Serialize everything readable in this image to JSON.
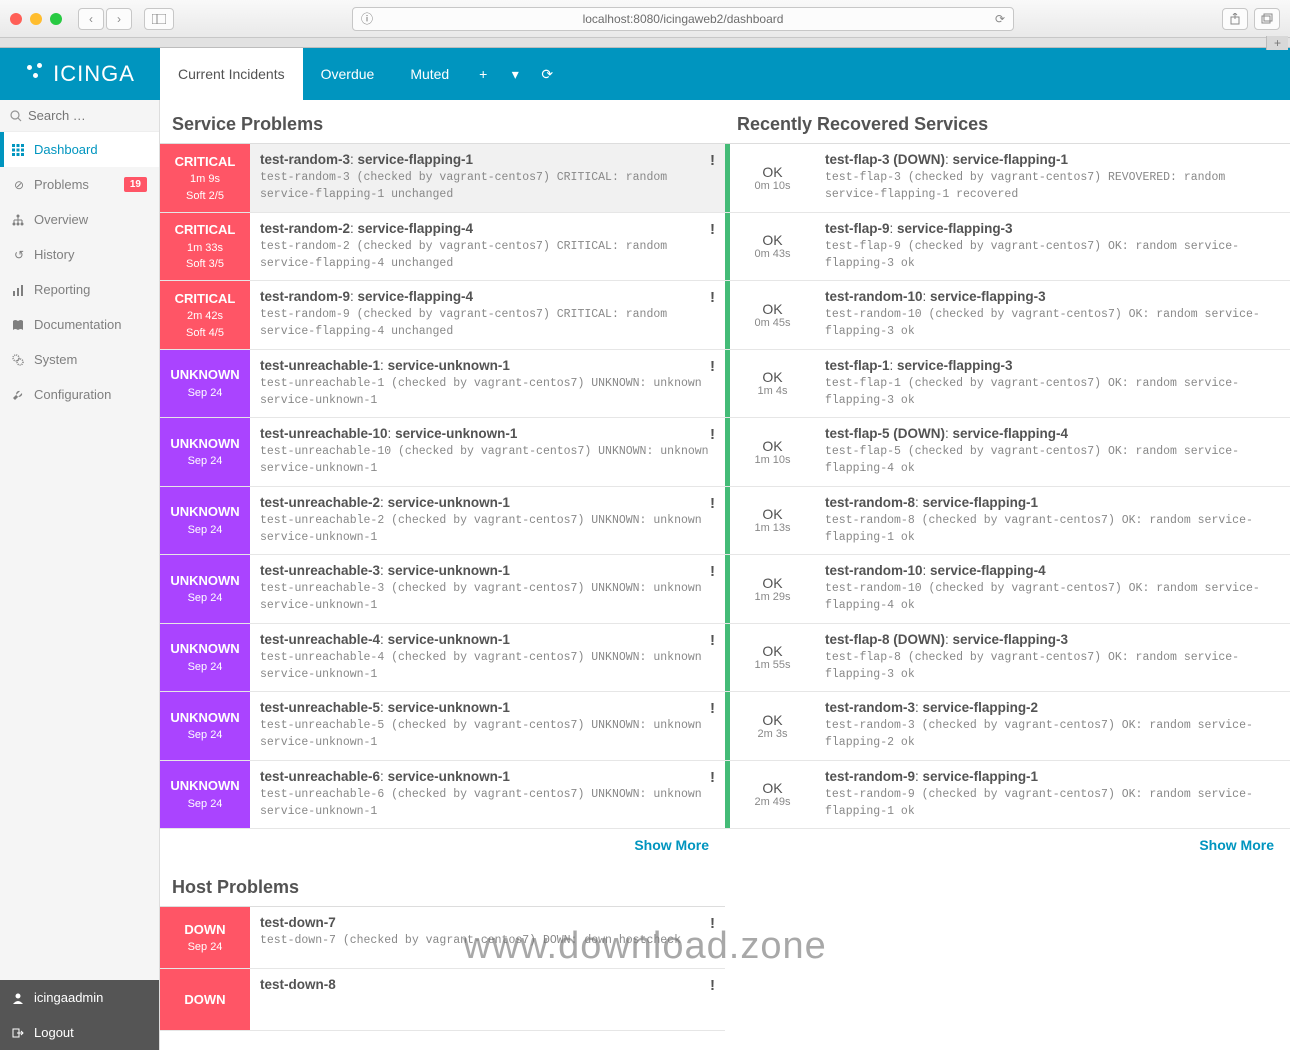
{
  "browser": {
    "url": "localhost:8080/icingaweb2/dashboard"
  },
  "logo_text": "ICINGA",
  "tabs": {
    "current": "Current Incidents",
    "overdue": "Overdue",
    "muted": "Muted"
  },
  "search_placeholder": "Search …",
  "sidebar": {
    "dashboard": "Dashboard",
    "problems": "Problems",
    "problems_badge": "19",
    "overview": "Overview",
    "history": "History",
    "reporting": "Reporting",
    "documentation": "Documentation",
    "system": "System",
    "configuration": "Configuration",
    "user": "icingaadmin",
    "logout": "Logout"
  },
  "headings": {
    "service_problems": "Service Problems",
    "recovered": "Recently Recovered Services",
    "host_problems": "Host Problems",
    "show_more": "Show More"
  },
  "service_problems": [
    {
      "status": "CRITICAL",
      "time": "1m 9s",
      "soft": "Soft 2/5",
      "cls": "critical",
      "host": "test-random-3",
      "svc": "service-flapping-1",
      "msg": "test-random-3 (checked by vagrant-centos7) CRITICAL: random service-flapping-1 unchanged",
      "hover": true
    },
    {
      "status": "CRITICAL",
      "time": "1m 33s",
      "soft": "Soft 3/5",
      "cls": "critical",
      "host": "test-random-2",
      "svc": "service-flapping-4",
      "msg": "test-random-2 (checked by vagrant-centos7) CRITICAL: random service-flapping-4 unchanged"
    },
    {
      "status": "CRITICAL",
      "time": "2m 42s",
      "soft": "Soft 4/5",
      "cls": "critical",
      "host": "test-random-9",
      "svc": "service-flapping-4",
      "msg": "test-random-9 (checked by vagrant-centos7) CRITICAL: random service-flapping-4 unchanged"
    },
    {
      "status": "UNKNOWN",
      "time": "Sep 24",
      "cls": "unknown",
      "host": "test-unreachable-1",
      "svc": "service-unknown-1",
      "msg": "test-unreachable-1 (checked by vagrant-centos7) UNKNOWN: unknown service-unknown-1"
    },
    {
      "status": "UNKNOWN",
      "time": "Sep 24",
      "cls": "unknown",
      "host": "test-unreachable-10",
      "svc": "service-unknown-1",
      "msg": "test-unreachable-10 (checked by vagrant-centos7) UNKNOWN: unknown service-unknown-1"
    },
    {
      "status": "UNKNOWN",
      "time": "Sep 24",
      "cls": "unknown",
      "host": "test-unreachable-2",
      "svc": "service-unknown-1",
      "msg": "test-unreachable-2 (checked by vagrant-centos7) UNKNOWN: unknown service-unknown-1"
    },
    {
      "status": "UNKNOWN",
      "time": "Sep 24",
      "cls": "unknown",
      "host": "test-unreachable-3",
      "svc": "service-unknown-1",
      "msg": "test-unreachable-3 (checked by vagrant-centos7) UNKNOWN: unknown service-unknown-1"
    },
    {
      "status": "UNKNOWN",
      "time": "Sep 24",
      "cls": "unknown",
      "host": "test-unreachable-4",
      "svc": "service-unknown-1",
      "msg": "test-unreachable-4 (checked by vagrant-centos7) UNKNOWN: unknown service-unknown-1"
    },
    {
      "status": "UNKNOWN",
      "time": "Sep 24",
      "cls": "unknown",
      "host": "test-unreachable-5",
      "svc": "service-unknown-1",
      "msg": "test-unreachable-5 (checked by vagrant-centos7) UNKNOWN: unknown service-unknown-1"
    },
    {
      "status": "UNKNOWN",
      "time": "Sep 24",
      "cls": "unknown",
      "host": "test-unreachable-6",
      "svc": "service-unknown-1",
      "msg": "test-unreachable-6 (checked by vagrant-centos7) UNKNOWN: unknown service-unknown-1"
    }
  ],
  "recovered": [
    {
      "time": "0m 10s",
      "host": "test-flap-3 (DOWN)",
      "svc": "service-flapping-1",
      "msg": "test-flap-3 (checked by vagrant-centos7) REVOVERED: random service-flapping-1 recovered"
    },
    {
      "time": "0m 43s",
      "host": "test-flap-9",
      "svc": "service-flapping-3",
      "msg": "test-flap-9 (checked by vagrant-centos7) OK: random service-flapping-3 ok"
    },
    {
      "time": "0m 45s",
      "host": "test-random-10",
      "svc": "service-flapping-3",
      "msg": "test-random-10 (checked by vagrant-centos7) OK: random service-flapping-3 ok"
    },
    {
      "time": "1m 4s",
      "host": "test-flap-1",
      "svc": "service-flapping-3",
      "msg": "test-flap-1 (checked by vagrant-centos7) OK: random service-flapping-3 ok"
    },
    {
      "time": "1m 10s",
      "host": "test-flap-5 (DOWN)",
      "svc": "service-flapping-4",
      "msg": "test-flap-5 (checked by vagrant-centos7) OK: random service-flapping-4 ok"
    },
    {
      "time": "1m 13s",
      "host": "test-random-8",
      "svc": "service-flapping-1",
      "msg": "test-random-8 (checked by vagrant-centos7) OK: random service-flapping-1 ok"
    },
    {
      "time": "1m 29s",
      "host": "test-random-10",
      "svc": "service-flapping-4",
      "msg": "test-random-10 (checked by vagrant-centos7) OK: random service-flapping-4 ok"
    },
    {
      "time": "1m 55s",
      "host": "test-flap-8 (DOWN)",
      "svc": "service-flapping-3",
      "msg": "test-flap-8 (checked by vagrant-centos7) OK: random service-flapping-3 ok"
    },
    {
      "time": "2m 3s",
      "host": "test-random-3",
      "svc": "service-flapping-2",
      "msg": "test-random-3 (checked by vagrant-centos7) OK: random service-flapping-2 ok"
    },
    {
      "time": "2m 49s",
      "host": "test-random-9",
      "svc": "service-flapping-1",
      "msg": "test-random-9 (checked by vagrant-centos7) OK: random service-flapping-1 ok"
    }
  ],
  "ok_label": "OK",
  "host_problems": [
    {
      "status": "DOWN",
      "time": "Sep 24",
      "cls": "down",
      "host": "test-down-7",
      "msg": "test-down-7 (checked by vagrant-centos7) DOWN: down hostcheck"
    },
    {
      "status": "DOWN",
      "time": "",
      "cls": "down",
      "host": "test-down-8",
      "msg": ""
    }
  ],
  "watermark": "www.download.zone"
}
